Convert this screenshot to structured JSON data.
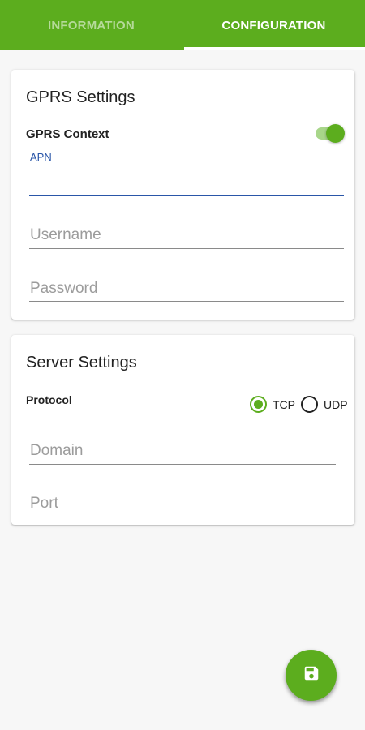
{
  "tabs": [
    {
      "label": "INFORMATION",
      "active": false
    },
    {
      "label": "CONFIGURATION",
      "active": true
    }
  ],
  "gprs": {
    "title": "GPRS Settings",
    "context_label": "GPRS Context",
    "context_enabled": true,
    "apn": {
      "label": "APN",
      "value": ""
    },
    "username": {
      "placeholder": "Username",
      "value": ""
    },
    "password": {
      "placeholder": "Password",
      "value": ""
    }
  },
  "server": {
    "title": "Server Settings",
    "protocol_label": "Protocol",
    "protocol_options": [
      {
        "label": "TCP",
        "selected": true
      },
      {
        "label": "UDP",
        "selected": false
      }
    ],
    "domain": {
      "placeholder": "Domain",
      "value": ""
    },
    "port": {
      "placeholder": "Port",
      "value": ""
    }
  },
  "fab": {
    "icon": "save-icon"
  },
  "colors": {
    "accent": "#5cad1e",
    "focus_blue": "#2a56a8",
    "background": "#f7f7f7"
  }
}
